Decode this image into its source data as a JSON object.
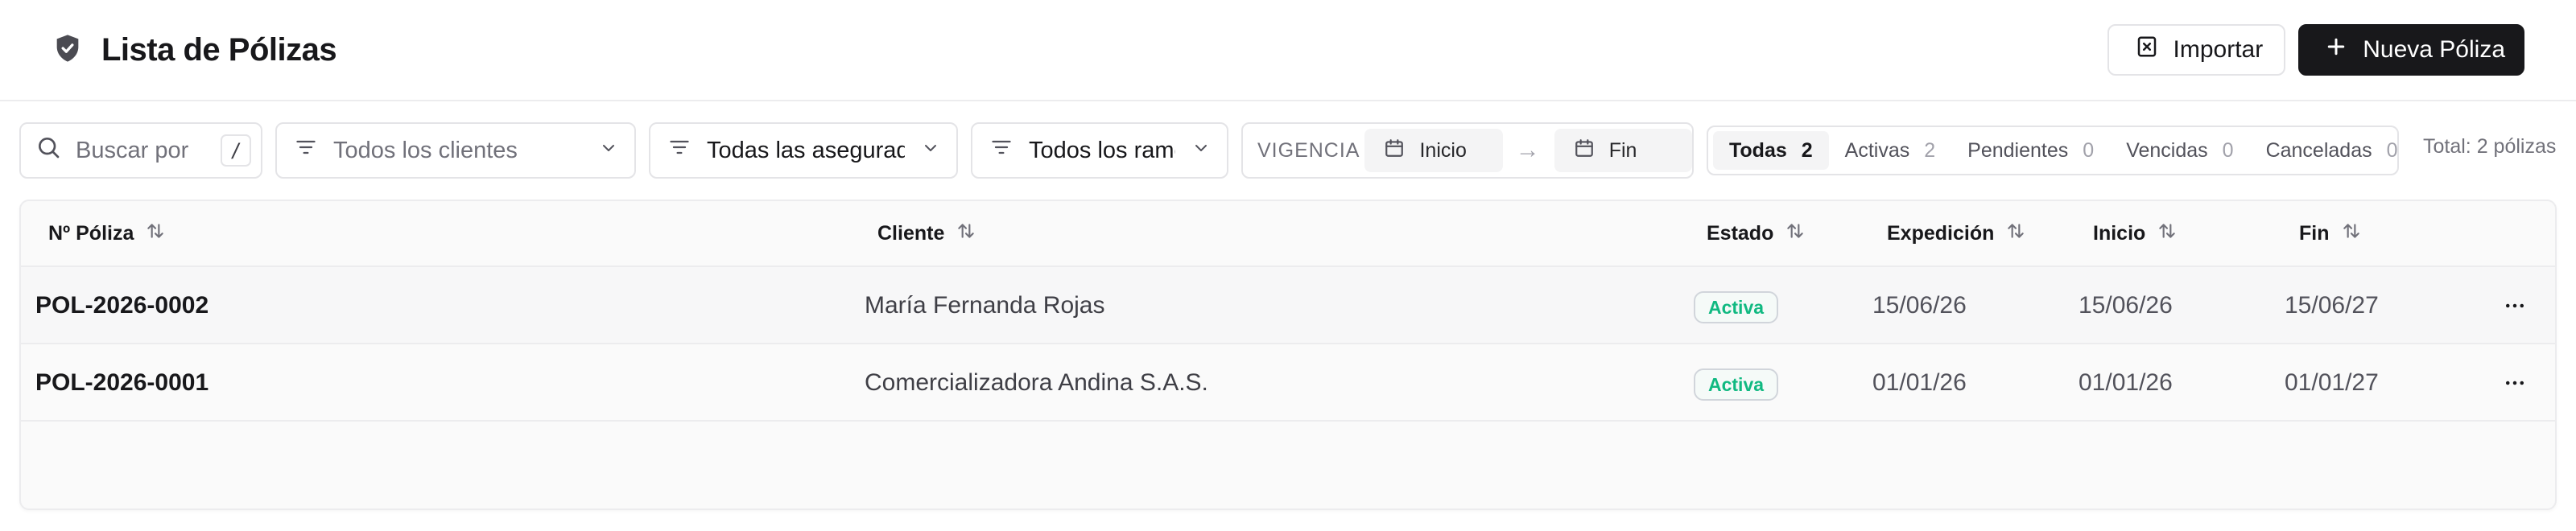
{
  "header": {
    "title": "Lista de Pólizas",
    "import_label": "Importar",
    "new_label": "Nueva Póliza"
  },
  "filters": {
    "search_placeholder": "Buscar por",
    "search_shortcut": "/",
    "clients_value": "Todos los clientes",
    "insurers_value": "Todas las aseguradoras",
    "branches_value": "Todos los ramos",
    "vigencia_label": "VIGENCIA",
    "start_placeholder": "Inicio",
    "end_placeholder": "Fin",
    "date_arrow": "→"
  },
  "status_tabs": [
    {
      "label": "Todas",
      "count": "2"
    },
    {
      "label": "Activas",
      "count": "2"
    },
    {
      "label": "Pendientes",
      "count": "0"
    },
    {
      "label": "Vencidas",
      "count": "0"
    },
    {
      "label": "Canceladas",
      "count": "0"
    }
  ],
  "total_text": "Total: 2 pólizas",
  "table": {
    "columns": [
      "Nº Póliza",
      "Cliente",
      "Estado",
      "Expedición",
      "Inicio",
      "Fin"
    ],
    "rows": [
      {
        "number": "POL-2026-0002",
        "client": "María Fernanda Rojas",
        "status": "Activa",
        "issued": "15/06/26",
        "start": "15/06/26",
        "end": "15/06/27"
      },
      {
        "number": "POL-2026-0001",
        "client": "Comercializadora Andina S.A.S.",
        "status": "Activa",
        "issued": "01/01/26",
        "start": "01/01/26",
        "end": "01/01/27"
      }
    ]
  },
  "colors": {
    "primary": "#18181b",
    "border": "#e4e4e7",
    "status_active": "#10b981"
  }
}
